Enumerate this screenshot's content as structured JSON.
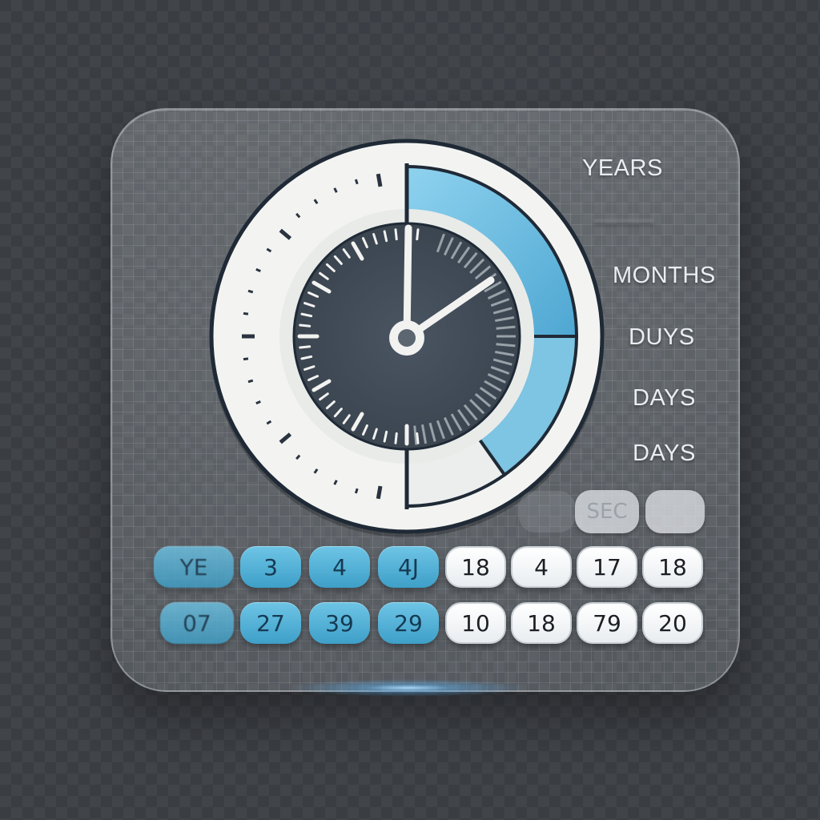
{
  "side_labels": {
    "years": "YEARS",
    "months": "MONTHS",
    "duys": "DUYS",
    "days_1": "DAYS",
    "days_2": "DAYS"
  },
  "small_chips": {
    "sec": "SEC"
  },
  "grid": {
    "row1": [
      "YE",
      "3",
      "4",
      "4J",
      "18",
      "4",
      "17",
      "18"
    ],
    "row2": [
      "07",
      "27",
      "39",
      "29",
      "10",
      "18",
      "79",
      "20"
    ]
  },
  "colors": {
    "accent_blue": "#5ab4dc",
    "dial_white": "#f1f2f0",
    "dial_dark": "#2f3a45",
    "panel_border": "#dfe5ea"
  },
  "icons": {
    "dial": "clock-dial-icon"
  }
}
